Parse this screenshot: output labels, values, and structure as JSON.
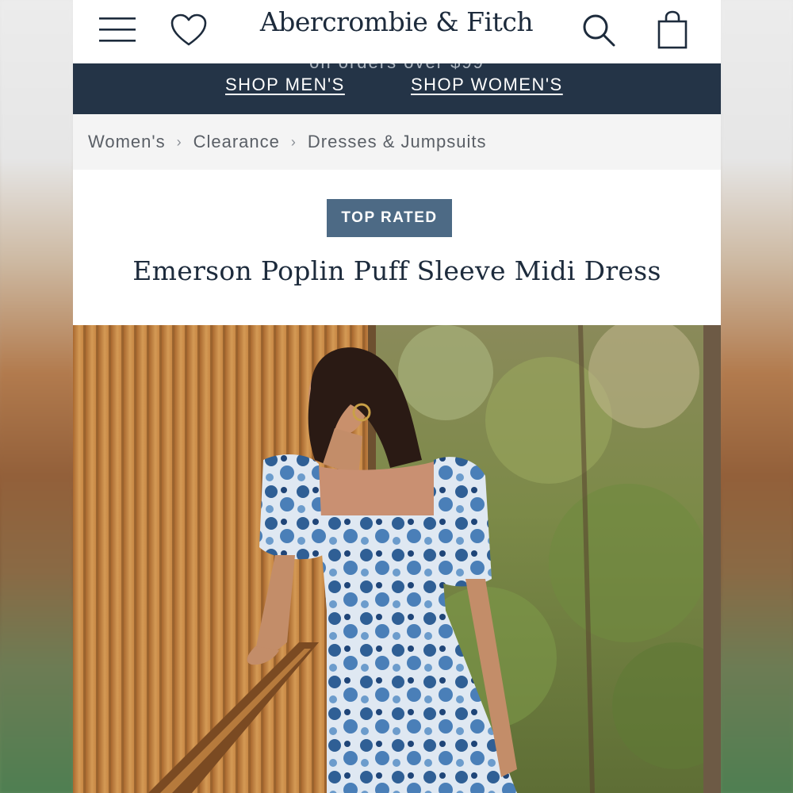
{
  "header": {
    "logo": "Abercrombie & Fitch",
    "icons": [
      "menu-icon",
      "heart-icon",
      "search-icon",
      "shopping-bag-icon"
    ]
  },
  "promo": {
    "partial_text": "on orders over $99",
    "shop_mens": "SHOP MEN'S",
    "shop_womens": "SHOP WOMEN'S"
  },
  "breadcrumb": {
    "items": [
      "Women's",
      "Clearance",
      "Dresses & Jumpsuits"
    ]
  },
  "product": {
    "badge": "TOP RATED",
    "title": "Emerson Poplin Puff Sleeve Midi Dress"
  },
  "colors": {
    "brand_navy": "#1d2b3c",
    "promo_bg": "#243447",
    "badge_bg": "#4d6a85",
    "breadcrumb_bg": "#f4f4f4"
  }
}
